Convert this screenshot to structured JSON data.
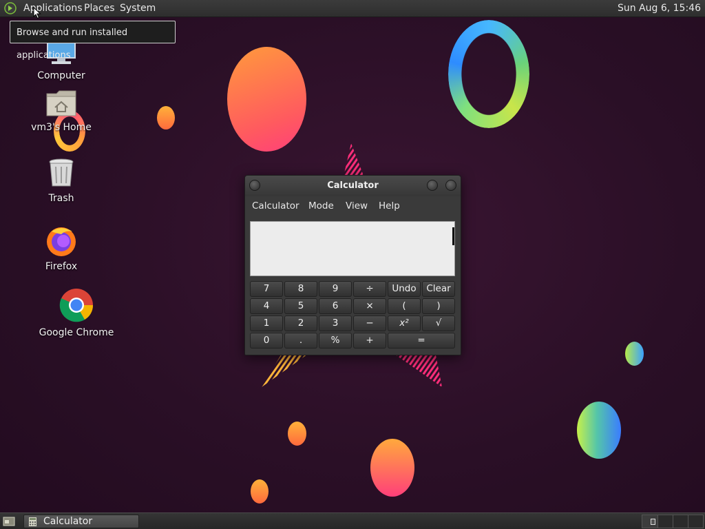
{
  "top_panel": {
    "menus": [
      "Applications",
      "Places",
      "System"
    ],
    "clock": "Sun Aug  6, 15:46"
  },
  "tooltip": "Browse and run installed applications",
  "desktop_icons": [
    {
      "label": "Computer",
      "icon": "computer-icon"
    },
    {
      "label": "vm3's Home",
      "icon": "home-folder-icon"
    },
    {
      "label": "Trash",
      "icon": "trash-icon"
    },
    {
      "label": "Firefox",
      "icon": "firefox-icon"
    },
    {
      "label": "Google Chrome",
      "icon": "chrome-icon"
    }
  ],
  "calculator": {
    "title": "Calculator",
    "menu": [
      "Calculator",
      "Mode",
      "View",
      "Help"
    ],
    "display": "",
    "keys": [
      [
        "7",
        "8",
        "9",
        "÷",
        "Undo",
        "Clear"
      ],
      [
        "4",
        "5",
        "6",
        "×",
        "(",
        ")"
      ],
      [
        "1",
        "2",
        "3",
        "−",
        "x²",
        "√"
      ],
      [
        "0",
        ".",
        "%",
        "+",
        "="
      ]
    ]
  },
  "taskbar": {
    "items": [
      {
        "label": "Calculator",
        "icon": "calculator-icon"
      }
    ]
  },
  "colors": {
    "desktop_bg": "#2a0f24",
    "panel_bg": "#2e2e2e",
    "display_bg": "#ececec"
  }
}
